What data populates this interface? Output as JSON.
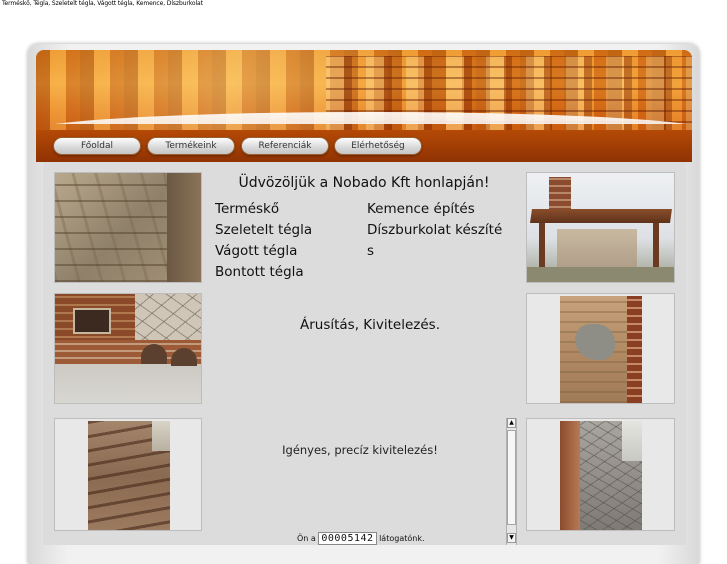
{
  "page_title_bar": "Terméskő, Tégla, Szeletelt tégla, Vágott tégla, Kemence, Díszburkolat",
  "nav": {
    "items": [
      {
        "label": "Főoldal"
      },
      {
        "label": "Termékeink"
      },
      {
        "label": "Referenciák"
      },
      {
        "label": "Elérhetőség"
      }
    ]
  },
  "main": {
    "welcome": "Üdvözöljük a Nobado Kft honlapján!",
    "products_left": [
      "Terméskő",
      "Szeletelt tégla",
      "Vágott tégla",
      "Bontott tégla"
    ],
    "products_right": [
      "Kemence építés",
      "Díszburkolat készíté",
      "s"
    ],
    "sales_line": "Árusítás, Kivitelezés.",
    "quality_line": "Igényes, precíz kivitelezés!",
    "visitor_prefix": "Ön a",
    "visitor_count": "00005142",
    "visitor_suffix": "látogatónk."
  },
  "scrollbar": {
    "up": "▲",
    "down": "▼"
  },
  "colors": {
    "header_orange": "#e47515",
    "content_bg": "#dcdcdc",
    "frame_bg": "#f1f1f1"
  }
}
